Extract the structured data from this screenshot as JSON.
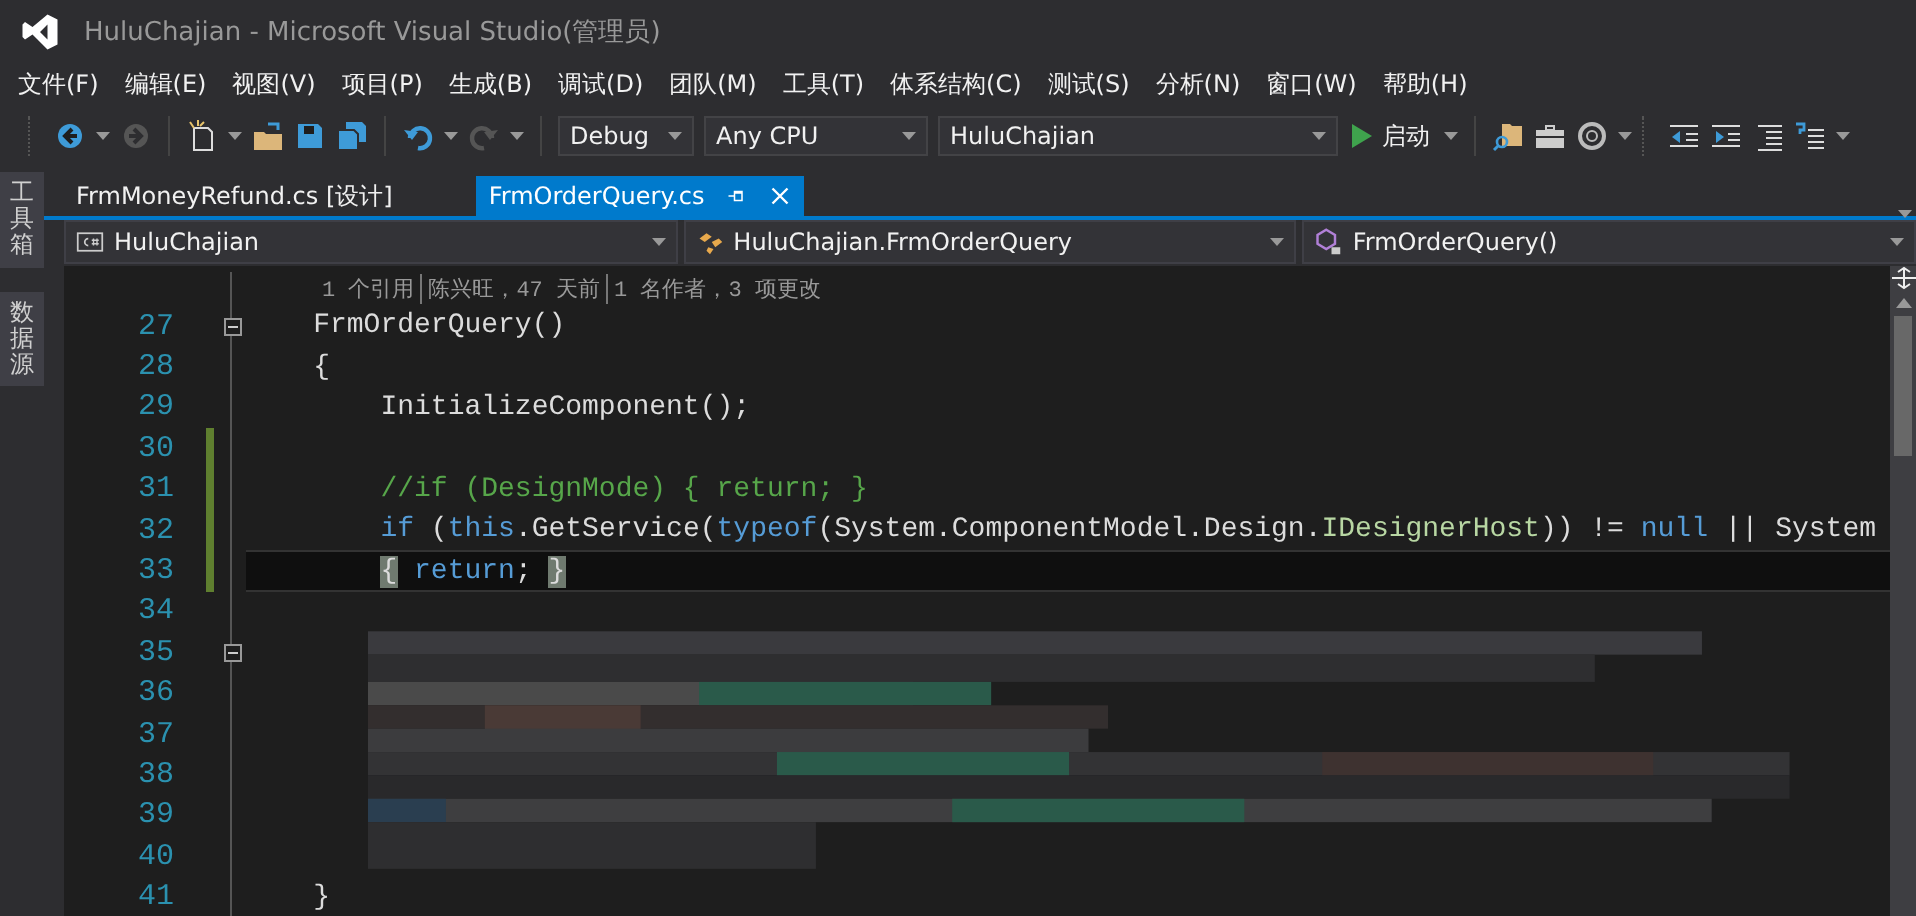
{
  "window": {
    "title": "HuluChajian - Microsoft Visual Studio(管理员)"
  },
  "menu": [
    "文件(F)",
    "编辑(E)",
    "视图(V)",
    "项目(P)",
    "生成(B)",
    "调试(D)",
    "团队(M)",
    "工具(T)",
    "体系结构(C)",
    "测试(S)",
    "分析(N)",
    "窗口(W)",
    "帮助(H)"
  ],
  "toolbar": {
    "configuration": "Debug",
    "platform": "Any CPU",
    "startup_project": "HuluChajian",
    "start_label": "启动"
  },
  "side_tabs": [
    "工具箱",
    "数据源"
  ],
  "tabs": [
    {
      "label": "FrmMoneyRefund.cs [设计]",
      "selected": false
    },
    {
      "label": "FrmOrderQuery.cs",
      "selected": true
    }
  ],
  "navigation": {
    "project": "HuluChajian",
    "type": "HuluChajian.FrmOrderQuery",
    "member": "FrmOrderQuery()"
  },
  "editor": {
    "codelens": [
      "1 个引用",
      "陈兴旺，47 天前",
      "1 名作者，3 项更改"
    ],
    "lines": [
      {
        "number": "27",
        "fold": true,
        "changed": false,
        "current": false,
        "tokens": [
          {
            "kind": "plain",
            "text": "    FrmOrderQuery()"
          }
        ]
      },
      {
        "number": "28",
        "fold": false,
        "changed": false,
        "current": false,
        "tokens": [
          {
            "kind": "plain",
            "text": "    {"
          }
        ]
      },
      {
        "number": "29",
        "fold": false,
        "changed": false,
        "current": false,
        "tokens": [
          {
            "kind": "plain",
            "text": "        InitializeComponent();"
          }
        ]
      },
      {
        "number": "30",
        "fold": false,
        "changed": true,
        "current": false
      },
      {
        "number": "31",
        "fold": false,
        "changed": true,
        "current": false,
        "tokens": [
          {
            "kind": "comment",
            "text": "        //if (DesignMode) { return; }"
          }
        ]
      },
      {
        "number": "32",
        "fold": false,
        "changed": true,
        "current": false,
        "tokens": [
          {
            "kind": "keyword",
            "text": "        if"
          },
          {
            "kind": "plain",
            "text": " ("
          },
          {
            "kind": "keyword",
            "text": "this"
          },
          {
            "kind": "plain",
            "text": ".GetService("
          },
          {
            "kind": "keyword",
            "text": "typeof"
          },
          {
            "kind": "plain",
            "text": "(System.ComponentModel.Design."
          },
          {
            "kind": "interface",
            "text": "IDesignerHost"
          },
          {
            "kind": "plain",
            "text": ")) != "
          },
          {
            "kind": "keyword",
            "text": "null"
          },
          {
            "kind": "plain",
            "text": " || System"
          }
        ]
      },
      {
        "number": "33",
        "fold": false,
        "changed": true,
        "current": true,
        "tokens": [
          {
            "kind": "brace_match",
            "text": "        {"
          },
          {
            "kind": "keyword",
            "text": " return"
          },
          {
            "kind": "plain",
            "text": "; "
          },
          {
            "kind": "brace_match",
            "text": "}"
          }
        ]
      },
      {
        "number": "34",
        "fold": false,
        "changed": false,
        "current": false
      },
      {
        "number": "35",
        "fold": true,
        "changed": false,
        "current": false
      },
      {
        "number": "36",
        "fold": false,
        "changed": false,
        "current": false
      },
      {
        "number": "37",
        "fold": false,
        "changed": false,
        "current": false
      },
      {
        "number": "38",
        "fold": false,
        "changed": false,
        "current": false
      },
      {
        "number": "39",
        "fold": false,
        "changed": false,
        "current": false
      },
      {
        "number": "40",
        "fold": false,
        "changed": false,
        "current": false
      },
      {
        "number": "41",
        "fold": false,
        "changed": false,
        "current": false,
        "tokens": [
          {
            "kind": "plain",
            "text": "    }"
          }
        ]
      }
    ]
  }
}
